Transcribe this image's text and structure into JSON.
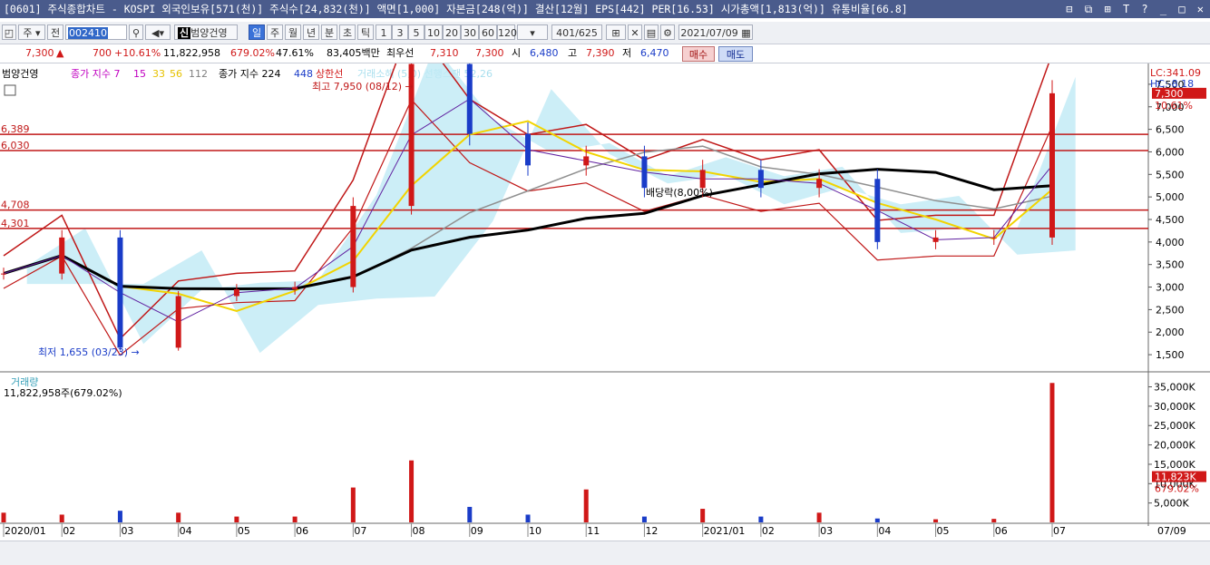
{
  "window": {
    "title": "[0601] 주식종합차트 - KOSPI 외국인보유[571(천)] 주식수[24,832(천)] 액면[1,000] 자본금[248(억)] 결산[12월] EPS[442] PER[16.53] 시가총액[1,813(억)] 유통비율[66.8]",
    "controls": "⊟ ⧉ ⊞ T ? _ □ ✕"
  },
  "toolbar": {
    "mode": "주",
    "prev_label": "전",
    "code": "002410",
    "stock_name": "범양건영",
    "periods": [
      "일",
      "주",
      "월",
      "년",
      "분",
      "초",
      "틱"
    ],
    "selected_period": "일",
    "intervals": [
      "1",
      "3",
      "5",
      "10",
      "20",
      "30",
      "60",
      "120"
    ],
    "count": "401",
    "total": "/625",
    "date": "2021/07/09"
  },
  "quote": {
    "price": "7,300",
    "arrow": "▲",
    "change": "700",
    "change_pct": "+10.61%",
    "volume": "11,822,958",
    "vol_ratio": "679.02%",
    "turnover": "47.61%",
    "amount": "83,405백만",
    "best_label": "최우선",
    "ask": "7,310",
    "bid": "7,300",
    "open_label": "시",
    "open": "6,480",
    "high_label": "고",
    "high": "7,390",
    "low_label": "저",
    "low": "6,470",
    "buy_label": "매수",
    "sell_label": "매도"
  },
  "colors": {
    "up": "#d01818",
    "down": "#1a3cc8",
    "envelope": "#c01818",
    "ichimoku_cloud": "#bfeaf5",
    "ma_black": "#000000",
    "ma_gray": "#909090",
    "ma_yellow": "#f2d400"
  },
  "chart_data": [
    {
      "type": "candlestick",
      "legend": [
        "범양건영",
        "종가 지수 7",
        "15",
        "33",
        "56",
        "112",
        "종가 지수 224",
        "448",
        "상한선"
      ],
      "legend_faded": "거래소해 (5,0) 선행스팬 52,26",
      "lc_label": "LC:341.09",
      "hc_label": "HC:-8.18",
      "y_ticks": [
        1500,
        2000,
        2500,
        3000,
        3500,
        4000,
        4500,
        5000,
        5500,
        6000,
        6500,
        7000,
        7500
      ],
      "ylim": [
        1200,
        7800
      ],
      "x_labels": [
        "2020/01",
        "02",
        "03",
        "04",
        "05",
        "06",
        "07",
        "08",
        "09",
        "10",
        "11",
        "12",
        "2021/01",
        "02",
        "03",
        "04",
        "05",
        "06",
        "07"
      ],
      "last_date": "07/09",
      "hlines": [
        {
          "label": "6,389",
          "value": 6389
        },
        {
          "label": "6,030",
          "value": 6030
        },
        {
          "label": "4,708",
          "value": 4708
        },
        {
          "label": "4,301",
          "value": 4301
        }
      ],
      "annotations": {
        "high": "최고 7,950 (08/12)",
        "low": "최저 1,655 (03/23)",
        "dividend": "배당락(8,00%)"
      },
      "current_price": "7,300",
      "current_pct": "10.61%",
      "price_points": [
        [
          "2020/01",
          3300
        ],
        [
          "02",
          4100
        ],
        [
          "03",
          1655
        ],
        [
          "04",
          2800
        ],
        [
          "05",
          2950
        ],
        [
          "06",
          3000
        ],
        [
          "07",
          4800
        ],
        [
          "08",
          7950
        ],
        [
          "09",
          6400
        ],
        [
          "10",
          5700
        ],
        [
          "11",
          5900
        ],
        [
          "12",
          5200
        ],
        [
          "2021/01",
          5600
        ],
        [
          "02",
          5200
        ],
        [
          "03",
          5400
        ],
        [
          "04",
          4000
        ],
        [
          "05",
          4100
        ],
        [
          "06",
          4100
        ],
        [
          "07",
          7300
        ]
      ]
    },
    {
      "type": "bar",
      "title": "거래량",
      "subtitle": "11,822,958주(679.02%)",
      "y_ticks": [
        "5,000K",
        "10,000K",
        "15,000K",
        "20,000K",
        "25,000K",
        "30,000K",
        "35,000K"
      ],
      "ylim": [
        0,
        37000
      ],
      "current_volume": "11,823K",
      "current_pct": "679.02%",
      "volume_points_k": [
        [
          "2020/01",
          2500
        ],
        [
          "02",
          2000
        ],
        [
          "03",
          3000
        ],
        [
          "04",
          2500
        ],
        [
          "05",
          1500
        ],
        [
          "06",
          1500
        ],
        [
          "07",
          9000
        ],
        [
          "08",
          16000
        ],
        [
          "09",
          4000
        ],
        [
          "10",
          2000
        ],
        [
          "11",
          8500
        ],
        [
          "12",
          1500
        ],
        [
          "2021/01",
          3500
        ],
        [
          "02",
          1500
        ],
        [
          "03",
          2500
        ],
        [
          "04",
          1000
        ],
        [
          "05",
          800
        ],
        [
          "06",
          900
        ],
        [
          "07",
          36000
        ]
      ]
    }
  ]
}
